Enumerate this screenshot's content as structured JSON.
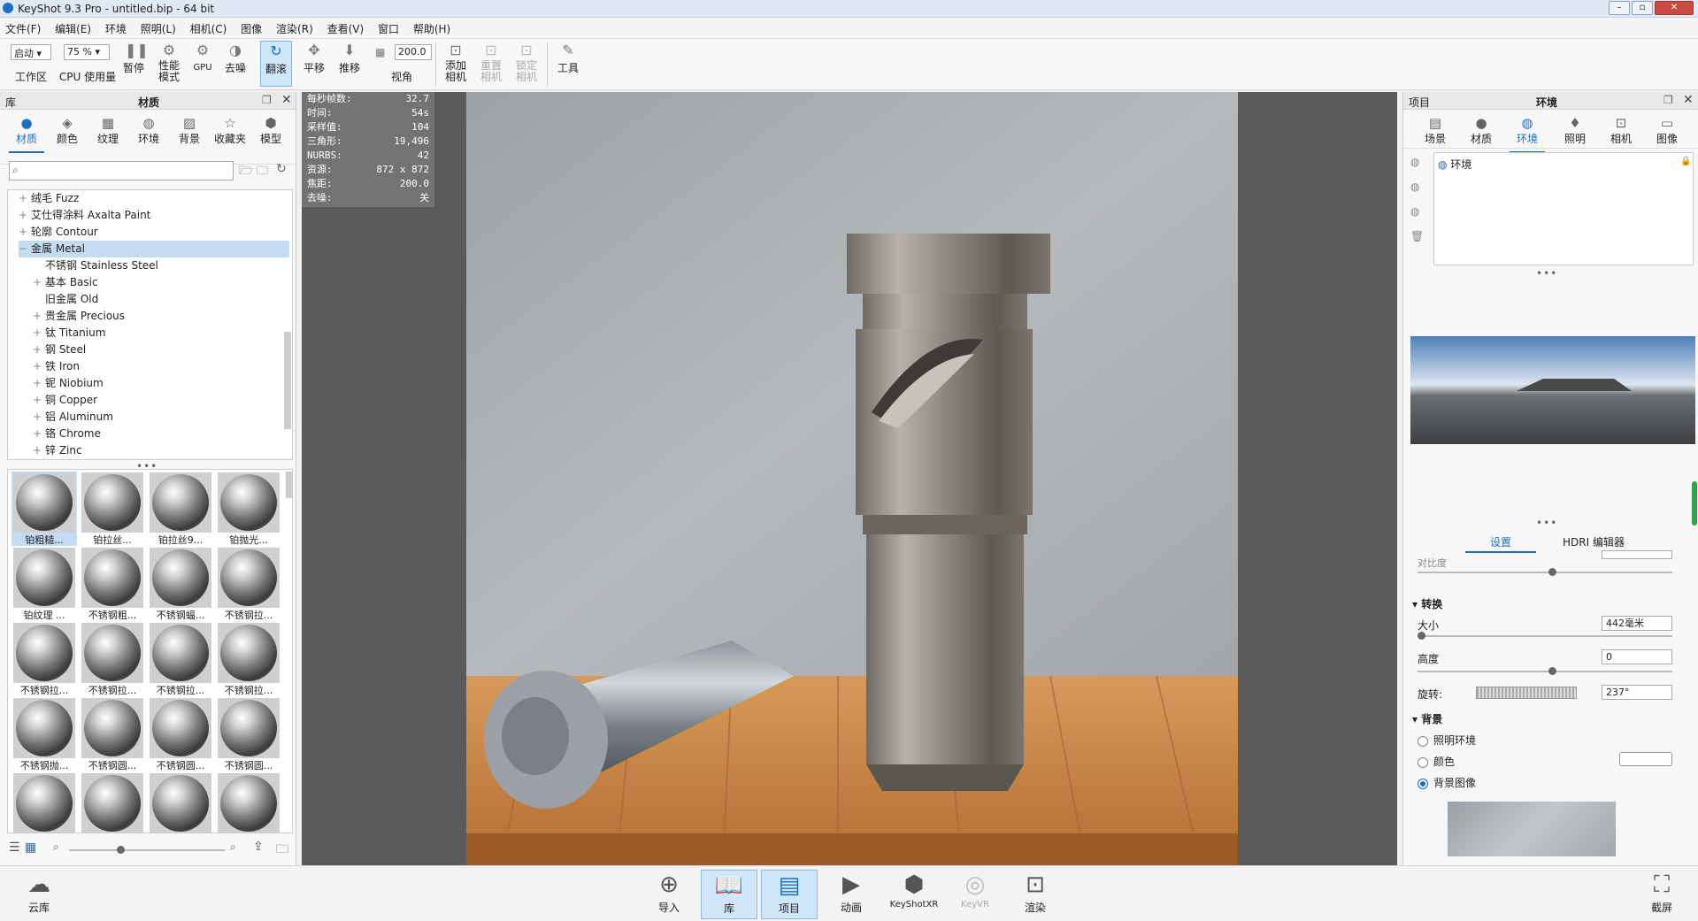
{
  "window": {
    "title": "KeyShot 9.3 Pro  - untitled.bip  - 64 bit"
  },
  "menu": [
    "文件(F)",
    "编辑(E)",
    "环境",
    "照明(L)",
    "相机(C)",
    "图像",
    "渲染(R)",
    "查看(V)",
    "窗口",
    "帮助(H)"
  ],
  "toolbar": {
    "workspace_combo": "启动",
    "workspace_label": "工作区",
    "cpu_combo": "75 %",
    "cpu_label": "CPU 使用量",
    "pause": "暂停",
    "perf": "性能模式",
    "gpu": "GPU",
    "denoise": "去噪",
    "tumble": "翻滚",
    "pan": "平移",
    "dolly": "推移",
    "fov_value": "200.0",
    "fov_label": "视角",
    "add_camera": "添加相机",
    "reset_camera": "重置相机",
    "lock_camera": "锁定相机",
    "tools": "工具"
  },
  "library": {
    "panel_title": "库",
    "section_title": "材质",
    "tabs": [
      "材质",
      "颜色",
      "纹理",
      "环境",
      "背景",
      "收藏夹",
      "模型"
    ],
    "selected_tab": "材质",
    "search_placeholder": "",
    "tree": [
      {
        "label": "绒毛 Fuzz",
        "level": 0,
        "expand": "+"
      },
      {
        "label": "艾仕得涂料 Axalta Paint",
        "level": 0,
        "expand": "+"
      },
      {
        "label": "轮廓 Contour",
        "level": 0,
        "expand": "+"
      },
      {
        "label": "金属 Metal",
        "level": 0,
        "expand": "−",
        "selected": true
      },
      {
        "label": "不锈钢 Stainless Steel",
        "level": 1,
        "expand": ""
      },
      {
        "label": "基本 Basic",
        "level": 1,
        "expand": "+"
      },
      {
        "label": "旧金属 Old",
        "level": 1,
        "expand": ""
      },
      {
        "label": "贵金属 Precious",
        "level": 1,
        "expand": "+"
      },
      {
        "label": "钛 Titanium",
        "level": 1,
        "expand": "+"
      },
      {
        "label": "钢 Steel",
        "level": 1,
        "expand": "+"
      },
      {
        "label": "铁 Iron",
        "level": 1,
        "expand": "+"
      },
      {
        "label": "铌 Niobium",
        "level": 1,
        "expand": "+"
      },
      {
        "label": "铜 Copper",
        "level": 1,
        "expand": "+"
      },
      {
        "label": "铝 Aluminum",
        "level": 1,
        "expand": "+"
      },
      {
        "label": "铬 Chrome",
        "level": 1,
        "expand": "+"
      },
      {
        "label": "锌 Zinc",
        "level": 1,
        "expand": "+"
      }
    ],
    "thumbs": [
      "铂粗糙...",
      "铂拉丝...",
      "铂拉丝9...",
      "铂抛光...",
      "铂纹理 ...",
      "不锈钢粗...",
      "不锈钢蝠...",
      "不锈钢拉...",
      "不锈钢拉...",
      "不锈钢拉...",
      "不锈钢拉...",
      "不锈钢拉...",
      "不锈钢抛...",
      "不锈钢圆...",
      "不锈钢圆...",
      "不锈钢圆...",
      "",
      "",
      "",
      ""
    ]
  },
  "stats": [
    {
      "k": "每秒帧数:",
      "v": "32.7"
    },
    {
      "k": "时间:",
      "v": "54s"
    },
    {
      "k": "采样值:",
      "v": "104"
    },
    {
      "k": "三角形:",
      "v": "19,496"
    },
    {
      "k": "NURBS:",
      "v": "42"
    },
    {
      "k": "资源:",
      "v": "872 x 872"
    },
    {
      "k": "焦距:",
      "v": "200.0"
    },
    {
      "k": "去噪:",
      "v": "关"
    }
  ],
  "project": {
    "panel_title": "项目",
    "section_title": "环境",
    "tabs": [
      "场景",
      "材质",
      "环境",
      "照明",
      "相机",
      "图像"
    ],
    "selected_tab": "环境",
    "env_item": "环境",
    "subtabs": [
      "设置",
      "HDRI 编辑器"
    ],
    "cut_label": "对比度",
    "transform_header": "转换",
    "size_label": "大小",
    "size_value": "442毫米",
    "height_label": "高度",
    "height_value": "0",
    "rotate_label": "旋转:",
    "rotate_value": "237°",
    "bg_header": "背景",
    "bg_options": [
      "照明环境",
      "颜色",
      "背景图像"
    ],
    "bg_selected": "背景图像"
  },
  "bottom": {
    "cloud": "云库",
    "items": [
      "导入",
      "库",
      "项目",
      "动画",
      "KeyShotXR",
      "KeyVR",
      "渲染"
    ],
    "screenshot": "截屏"
  }
}
